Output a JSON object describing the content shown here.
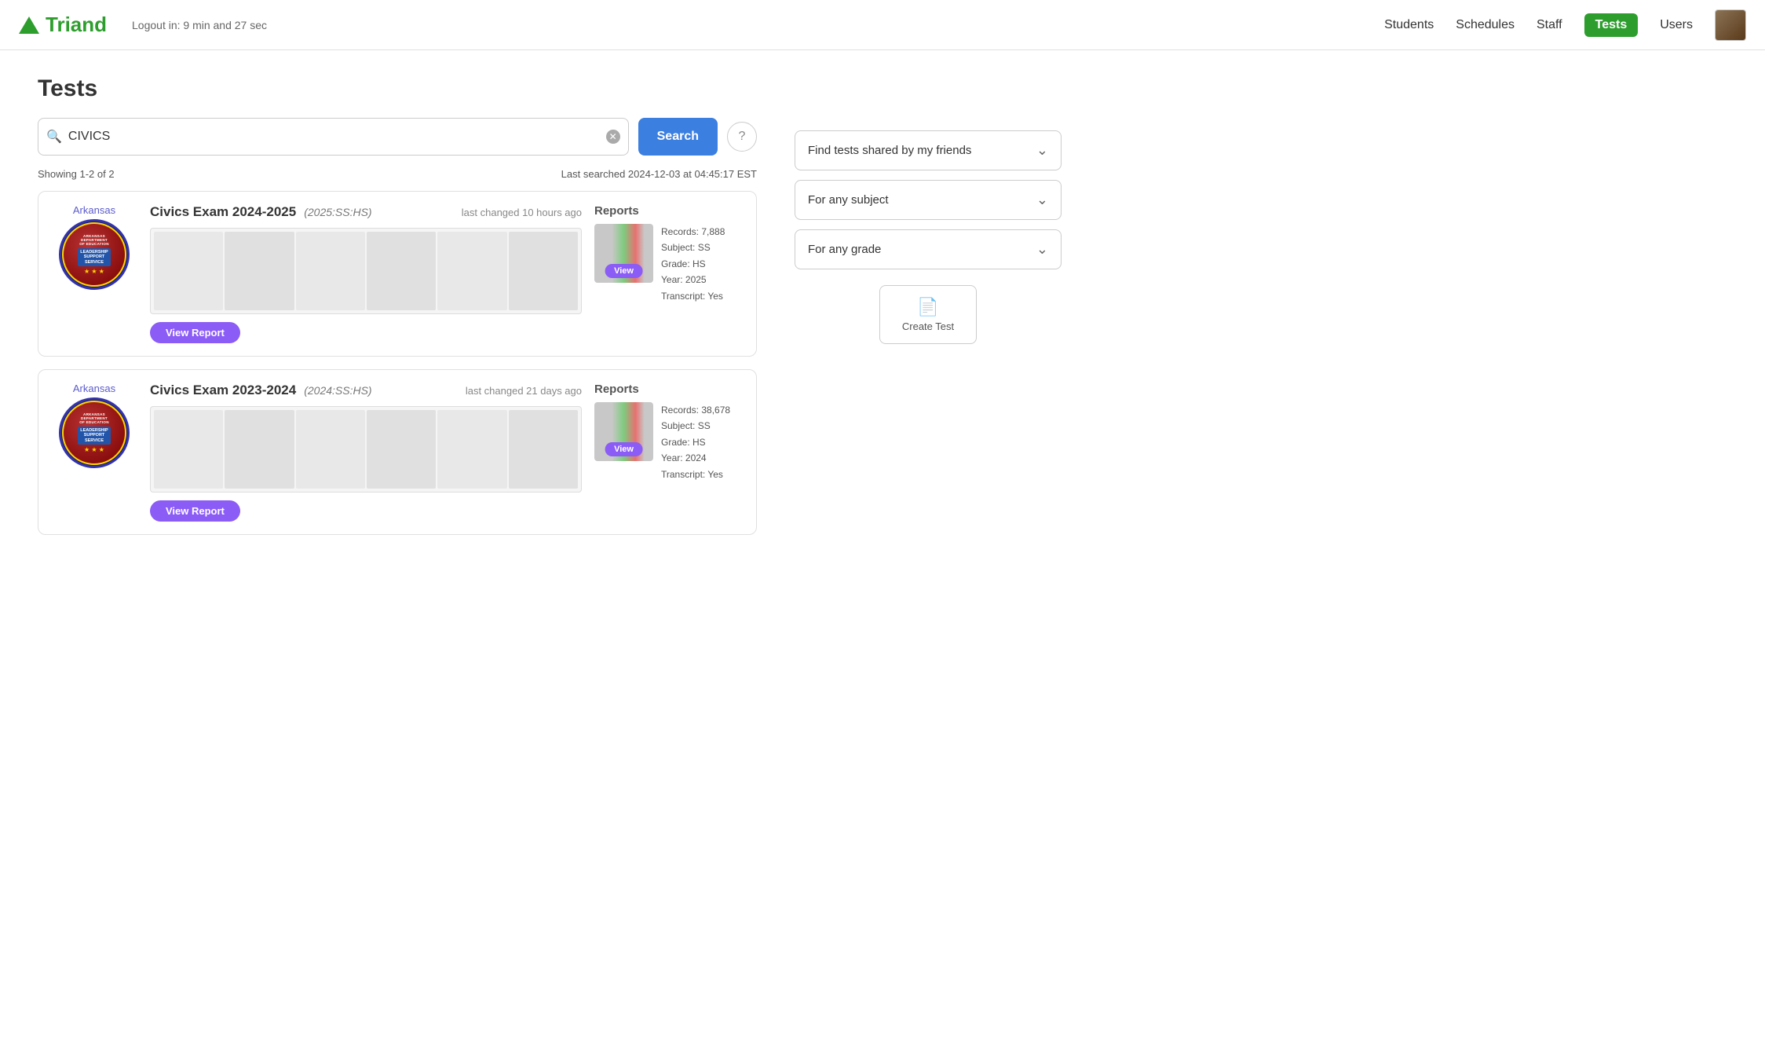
{
  "header": {
    "logo_text": "Triand",
    "logout_text": "Logout in: 9 min and 27 sec",
    "nav_links": [
      {
        "label": "Students",
        "active": false
      },
      {
        "label": "Schedules",
        "active": false
      },
      {
        "label": "Staff",
        "active": false
      },
      {
        "label": "Tests",
        "active": true
      },
      {
        "label": "Users",
        "active": false
      }
    ]
  },
  "page": {
    "title": "Tests",
    "search_value": "CIVICS",
    "search_placeholder": "Search",
    "search_button_label": "Search",
    "help_label": "?",
    "filter1": "Find tests shared by my friends",
    "filter2": "For any subject",
    "filter3": "For any grade",
    "create_test_label": "Create Test",
    "results_showing": "Showing 1-2 of 2",
    "last_searched": "Last searched 2024-12-03 at 04:45:17 EST"
  },
  "results": [
    {
      "source": "Arkansas",
      "title": "Civics Exam 2024-2025",
      "code": "(2025:SS:HS)",
      "changed": "last changed 10 hours ago",
      "view_report_label": "View Report",
      "reports_title": "Reports",
      "records": "Records: 7,888",
      "subject": "Subject: SS",
      "grade": "Grade: HS",
      "year": "Year: 2025",
      "transcript": "Transcript: Yes",
      "view_label": "View"
    },
    {
      "source": "Arkansas",
      "title": "Civics Exam 2023-2024",
      "code": "(2024:SS:HS)",
      "changed": "last changed 21 days ago",
      "view_report_label": "View Report",
      "reports_title": "Reports",
      "records": "Records: 38,678",
      "subject": "Subject: SS",
      "grade": "Grade: HS",
      "year": "Year: 2024",
      "transcript": "Transcript: Yes",
      "view_label": "View"
    }
  ]
}
